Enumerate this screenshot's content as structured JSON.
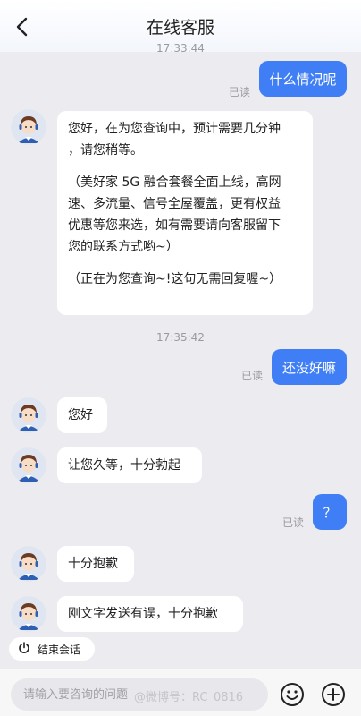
{
  "header": {
    "title": "在线客服"
  },
  "messages": {
    "ts1": "17:33:44",
    "out1": "什么情况呢",
    "read1": "已读",
    "in1": {
      "line1": "您好，在为您查询中，预计需要几分钟",
      "line2": "，请您稍等。",
      "line3": "（美好家 5G 融合套餐全面上线，高网",
      "line4": "速、多流量、信号全屋覆盖，更有权益",
      "line5": "优惠等您来选，如有需要请向客服留下",
      "line6": "您的联系方式哟~）",
      "line7": "（正在为您查询~!这句无需回复喔~）"
    },
    "ts2": "17:35:42",
    "out2": "还没好嘛",
    "read2": "已读",
    "in2": "您好",
    "in3": "让您久等，十分勃起",
    "out3": "？",
    "read3": "已读",
    "in4": "十分抱歉",
    "in5": "刚文字发送有误，十分抱歉"
  },
  "end_session": {
    "label": "结束会话",
    "icon": "power-icon"
  },
  "footer": {
    "placeholder": "请输入要咨询的问题",
    "watermark": "@微博号：RC_0816_",
    "emoji_icon": "emoji-icon",
    "plus_icon": "plus-icon"
  },
  "colors": {
    "accent": "#3f7ef4",
    "background": "#ececf0",
    "bubble_in": "#ffffff"
  }
}
